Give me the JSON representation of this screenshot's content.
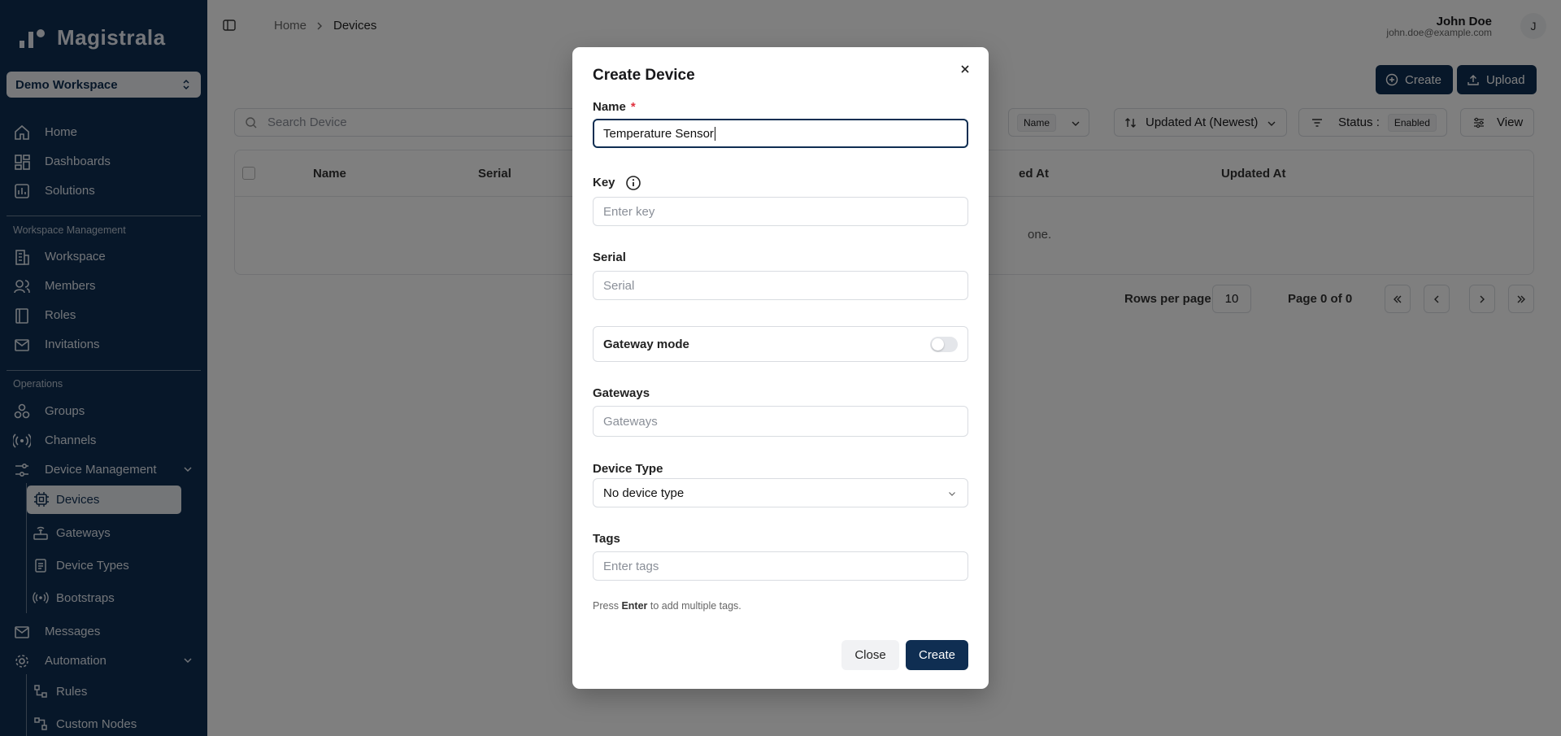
{
  "app": {
    "name": "Magistrala",
    "workspace": "Demo Workspace"
  },
  "sidebar": {
    "top_items": [
      {
        "label": "Home",
        "icon": "home-icon"
      },
      {
        "label": "Dashboards",
        "icon": "dashboard-icon"
      },
      {
        "label": "Solutions",
        "icon": "solutions-icon"
      }
    ],
    "section_workspace": "Workspace Management",
    "workspace_items": [
      {
        "label": "Workspace",
        "icon": "building-icon"
      },
      {
        "label": "Members",
        "icon": "users-icon"
      },
      {
        "label": "Roles",
        "icon": "book-icon"
      },
      {
        "label": "Invitations",
        "icon": "mail-icon"
      }
    ],
    "section_operations": "Operations",
    "operations_items": [
      {
        "label": "Groups",
        "icon": "groups-icon"
      },
      {
        "label": "Channels",
        "icon": "radio-icon"
      },
      {
        "label": "Device Management",
        "icon": "device-management-icon"
      }
    ],
    "device_sub_items": [
      {
        "label": "Devices",
        "icon": "cpu-icon",
        "active": true
      },
      {
        "label": "Gateways",
        "icon": "router-icon"
      },
      {
        "label": "Device Types",
        "icon": "clipboard-icon"
      },
      {
        "label": "Bootstraps",
        "icon": "signal-icon"
      }
    ],
    "more_items": [
      {
        "label": "Messages",
        "icon": "messages-icon"
      },
      {
        "label": "Automation",
        "icon": "gear-icon"
      }
    ],
    "automation_sub_items": [
      {
        "label": "Rules",
        "icon": "rules-icon"
      },
      {
        "label": "Custom Nodes",
        "icon": "nodes-icon"
      }
    ]
  },
  "header": {
    "breadcrumb_home": "Home",
    "breadcrumb_current": "Devices",
    "user_name": "John Doe",
    "user_email": "john.doe@example.com",
    "avatar_initial": "J"
  },
  "toolbar": {
    "create_label": "Create",
    "upload_label": "Upload",
    "search_placeholder": "Search Device",
    "filter_field": "Name",
    "sort_label": "Updated At (Newest)",
    "status_label": "Status :",
    "status_value": "Enabled",
    "view_label": "View"
  },
  "table": {
    "columns": [
      "Name",
      "Serial",
      "ed At",
      "Updated At"
    ],
    "empty_text": "one."
  },
  "pagination": {
    "rows_per_page_label": "Rows per page",
    "rows_per_page": "10",
    "page_info": "Page 0 of 0"
  },
  "modal": {
    "title": "Create Device",
    "name_label": "Name",
    "required_mark": "*",
    "name_value": "Temperature Sensor",
    "key_label": "Key",
    "key_placeholder": "Enter key",
    "serial_label": "Serial",
    "serial_placeholder": "Serial",
    "gateway_mode_label": "Gateway mode",
    "gateway_mode_on": false,
    "gateways_label": "Gateways",
    "gateways_placeholder": "Gateways",
    "device_type_label": "Device Type",
    "device_type_value": "No device type",
    "tags_label": "Tags",
    "tags_placeholder": "Enter tags",
    "hint_prefix": "Press",
    "hint_key": "Enter",
    "hint_suffix": "to add multiple tags.",
    "close_label": "Close",
    "create_label": "Create"
  },
  "colors": {
    "sidebar_bg": "#0f2e52",
    "primary": "#0f2e52",
    "required": "#e0313f"
  }
}
